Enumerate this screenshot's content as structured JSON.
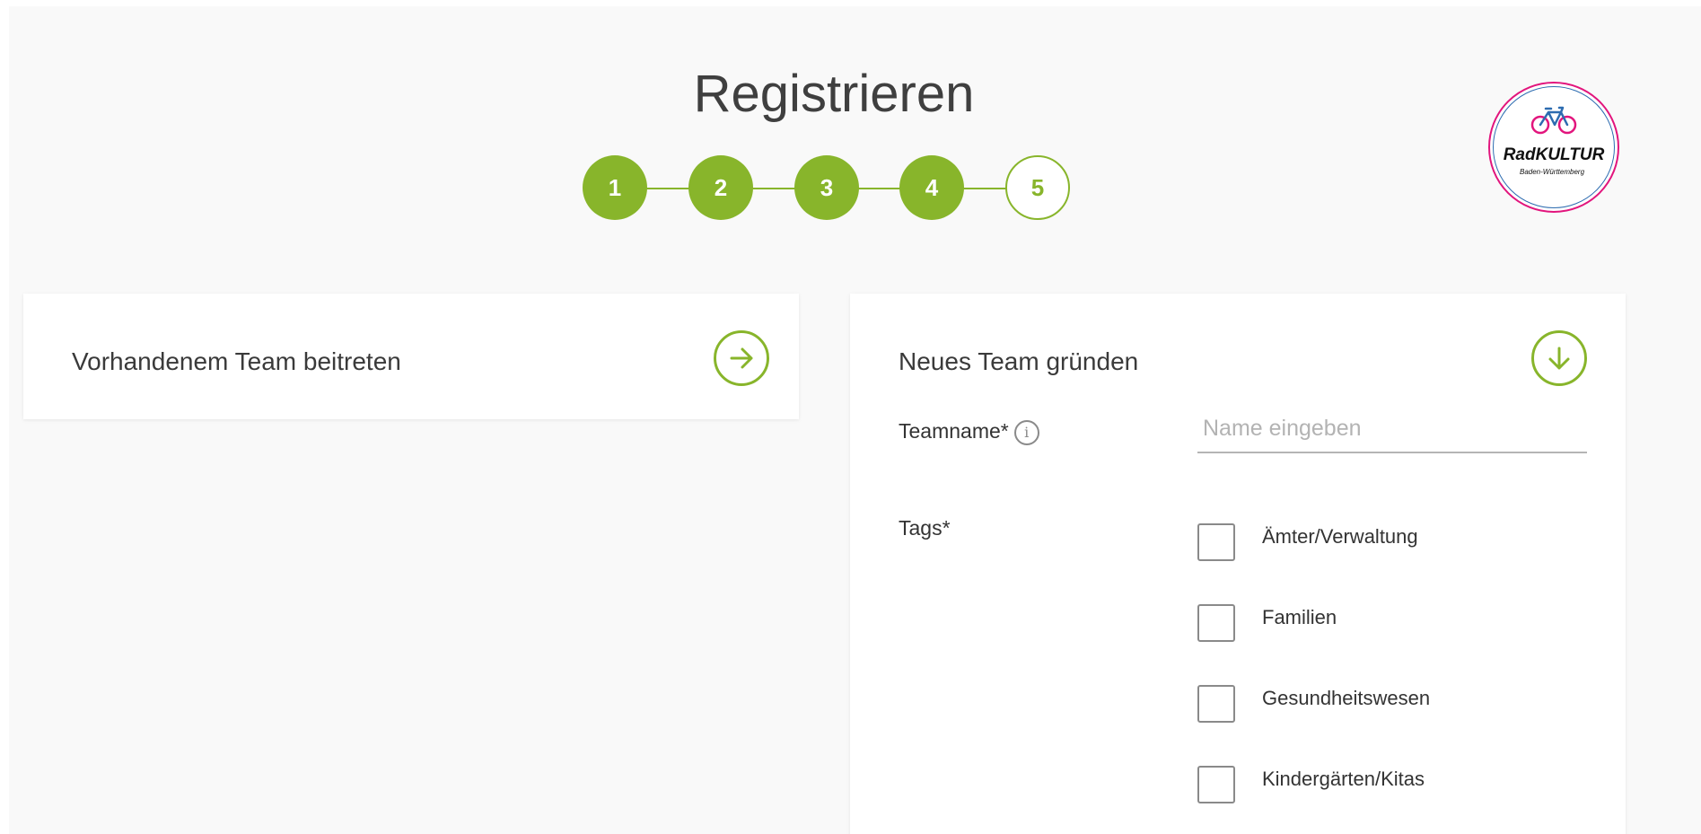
{
  "page": {
    "title": "Registrieren"
  },
  "stepper": {
    "steps": [
      {
        "label": "1",
        "state": "completed"
      },
      {
        "label": "2",
        "state": "completed"
      },
      {
        "label": "3",
        "state": "completed"
      },
      {
        "label": "4",
        "state": "completed"
      },
      {
        "label": "5",
        "state": "pending"
      }
    ],
    "current_step": 5,
    "total_steps": 5
  },
  "logo": {
    "name": "RadKULTUR",
    "subtitle": "Baden-Württemberg",
    "icon": "bicycle-icon"
  },
  "join_team": {
    "title": "Vorhandenem Team beitreten",
    "action_icon": "arrow-right-icon"
  },
  "new_team": {
    "title": "Neues Team gründen",
    "action_icon": "arrow-down-icon",
    "teamname": {
      "label": "Teamname*",
      "info_icon": "info-icon",
      "placeholder": "Name eingeben",
      "value": ""
    },
    "tags": {
      "label": "Tags*",
      "options": [
        {
          "label": "Ämter/Verwaltung",
          "checked": false
        },
        {
          "label": "Familien",
          "checked": false
        },
        {
          "label": "Gesundheitswesen",
          "checked": false
        },
        {
          "label": "Kindergärten/Kitas",
          "checked": false
        }
      ]
    }
  },
  "colors": {
    "accent": "#88b52b",
    "background": "#f9f9f9",
    "card": "#ffffff",
    "logo_ring_pink": "#e2157d",
    "logo_ring_blue": "#2d6cb0"
  }
}
